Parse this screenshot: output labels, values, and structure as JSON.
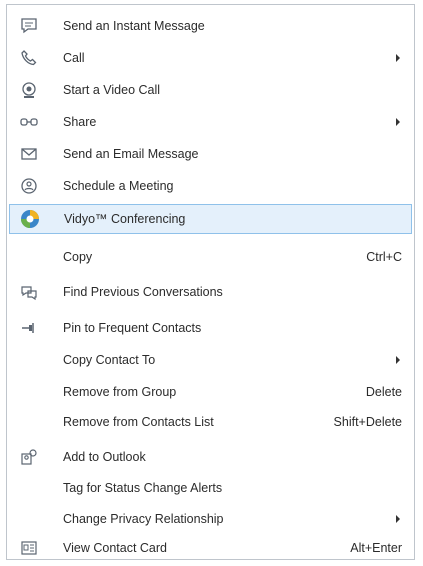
{
  "menu": {
    "items": [
      {
        "label": "Send an Instant Message",
        "icon": "chat-bubble-icon"
      },
      {
        "label": "Call",
        "icon": "phone-icon",
        "submenu": true
      },
      {
        "label": "Start a Video Call",
        "icon": "webcam-icon"
      },
      {
        "label": "Share",
        "icon": "share-icon",
        "submenu": true
      },
      {
        "label": "Send an Email Message",
        "icon": "envelope-icon"
      },
      {
        "label": "Schedule a Meeting",
        "icon": "meeting-icon"
      },
      {
        "label": "Vidyo™ Conferencing",
        "icon": "vidyo-icon",
        "highlighted": true
      },
      {
        "label": "Copy",
        "shortcut": "Ctrl+C"
      },
      {
        "label": "Find Previous Conversations",
        "icon": "conversation-history-icon"
      },
      {
        "label": "Pin to Frequent Contacts",
        "icon": "pin-icon"
      },
      {
        "label": "Copy Contact To",
        "submenu": true
      },
      {
        "label": "Remove from Group",
        "shortcut": "Delete"
      },
      {
        "label": "Remove from Contacts List",
        "shortcut": "Shift+Delete"
      },
      {
        "label": "Add to Outlook",
        "icon": "add-contact-icon"
      },
      {
        "label": "Tag for Status Change Alerts"
      },
      {
        "label": "Change Privacy Relationship",
        "submenu": true
      },
      {
        "label": "View Contact Card",
        "icon": "contact-card-icon",
        "shortcut": "Alt+Enter"
      }
    ]
  },
  "colors": {
    "highlight_bg": "#e4f0fb",
    "highlight_border": "#8fc1ea",
    "icon_stroke": "#5a6470"
  }
}
